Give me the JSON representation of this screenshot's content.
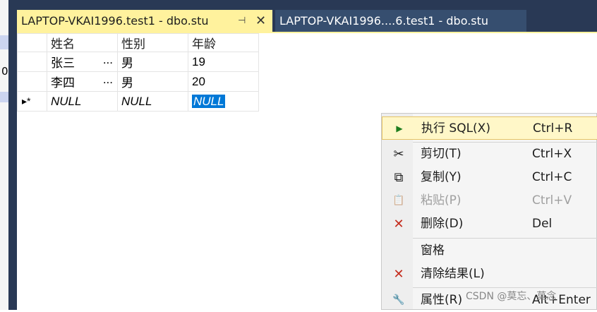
{
  "left": {
    "digit": "0"
  },
  "tabs": [
    {
      "label": "LAPTOP-VKAI1996.test1 - dbo.stu",
      "pin": "⊣",
      "close": "✕",
      "active": true
    },
    {
      "label": "LAPTOP-VKAI1996....6.test1 - dbo.stu",
      "active": false
    }
  ],
  "grid": {
    "columns": [
      "姓名",
      "性别",
      "年龄"
    ],
    "rows": [
      {
        "marker": "",
        "name": "张三",
        "ellipsis": "...",
        "gender": "男",
        "age": "19"
      },
      {
        "marker": "",
        "name": "李四",
        "ellipsis": "...",
        "gender": "男",
        "age": "20"
      },
      {
        "marker": "▸*",
        "name": "NULL",
        "ellipsis": "",
        "gender": "NULL",
        "age": "NULL"
      }
    ]
  },
  "menu": {
    "items": [
      {
        "icon": "execute-sql-icon",
        "glyph": "▶",
        "label": "执行 SQL(X)",
        "shortcut": "Ctrl+R"
      },
      {
        "icon": "cut-icon",
        "glyph": "✂",
        "label": "剪切(T)",
        "shortcut": "Ctrl+X"
      },
      {
        "icon": "copy-icon",
        "glyph": "⧉",
        "label": "复制(Y)",
        "shortcut": "Ctrl+C"
      },
      {
        "icon": "paste-icon",
        "glyph": "📋",
        "label": "粘贴(P)",
        "shortcut": "Ctrl+V"
      },
      {
        "icon": "delete-icon",
        "glyph": "✕",
        "label": "删除(D)",
        "shortcut": "Del"
      },
      {
        "icon": "",
        "glyph": "",
        "label": "窗格",
        "shortcut": ""
      },
      {
        "icon": "clear-results-icon",
        "glyph": "✕",
        "label": "清除结果(L)",
        "shortcut": ""
      },
      {
        "icon": "properties-icon",
        "glyph": "🔧",
        "label": "属性(R)",
        "shortcut": "Alt+Enter"
      }
    ]
  },
  "watermark": "CSDN @莫忘、莫念",
  "colors": {
    "tab_active": "#fff29d",
    "delete_red": "#c42b1c",
    "selection": "#0078d7"
  }
}
